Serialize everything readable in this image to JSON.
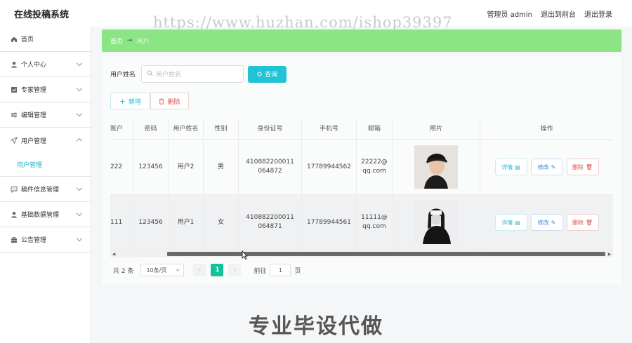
{
  "header": {
    "app_title": "在线投稿系统",
    "watermark": "https://www.huzhan.com/ishop39397",
    "admin_label": "管理员 admin",
    "back_to_front": "退出到前台",
    "logout": "退出登录"
  },
  "sidebar": {
    "items": [
      {
        "label": "首页",
        "icon": "home-icon"
      },
      {
        "label": "个人中心",
        "icon": "user-icon"
      },
      {
        "label": "专家管理",
        "icon": "chart-icon"
      },
      {
        "label": "编辑管理",
        "icon": "sliders-icon"
      },
      {
        "label": "用户管理",
        "icon": "send-icon"
      },
      {
        "label": "稿件信息管理",
        "icon": "message-icon"
      },
      {
        "label": "基础数据管理",
        "icon": "user-icon"
      },
      {
        "label": "公告管理",
        "icon": "briefcase-icon"
      }
    ],
    "sub_item": "用户管理"
  },
  "breadcrumb": {
    "home": "首页",
    "separator": "→",
    "current": "用户"
  },
  "search": {
    "label": "用户姓名",
    "placeholder": "用户姓名",
    "query_button": "查询"
  },
  "actions": {
    "add": "新增",
    "delete": "删除"
  },
  "table": {
    "headers": [
      "账户",
      "密码",
      "用户姓名",
      "性别",
      "身份证号",
      "手机号",
      "邮箱",
      "照片",
      "操作"
    ],
    "rows": [
      {
        "account": "222",
        "password": "123456",
        "name": "用户2",
        "gender": "男",
        "id_number": "410882200011064872",
        "phone": "17789944562",
        "email": "22222@qq.com"
      },
      {
        "account": "111",
        "password": "123456",
        "name": "用户1",
        "gender": "女",
        "id_number": "410882200011064871",
        "phone": "17789944561",
        "email": "11111@qq.com"
      }
    ],
    "op_detail": "详情",
    "op_edit": "修改",
    "op_remove": "删除"
  },
  "pagination": {
    "total": "共 2 条",
    "page_size": "10条/页",
    "current_page": "1",
    "goto_label": "前往",
    "goto_value": "1",
    "page_unit": "页"
  },
  "banner": "专业毕设代做",
  "colors": {
    "accent": "#22c3d6",
    "breadcrumb_bg": "#8be584",
    "page_active": "#13c29a",
    "danger": "#e2524c"
  }
}
